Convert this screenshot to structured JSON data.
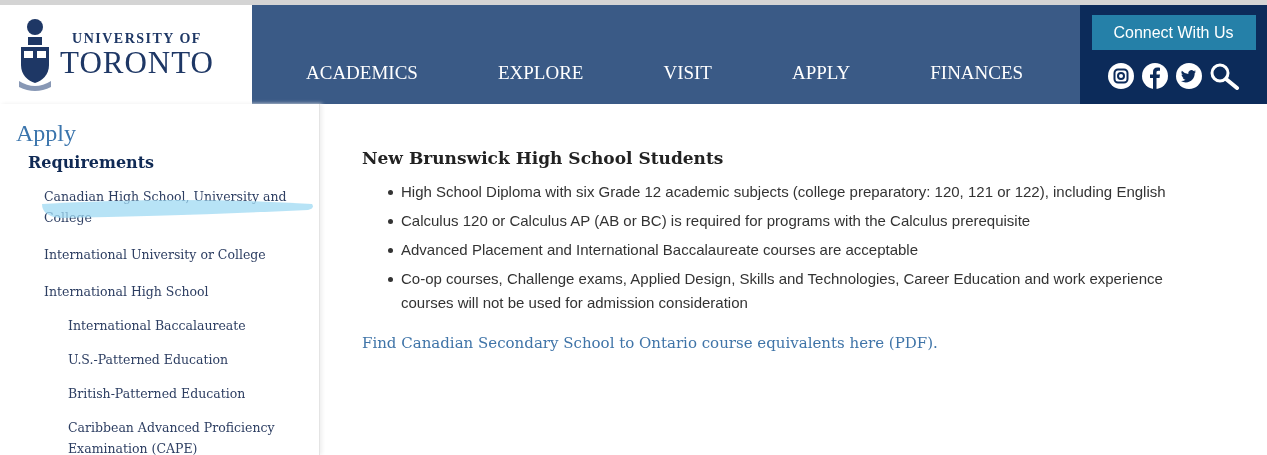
{
  "logo": {
    "line_1": "UNIVERSITY OF",
    "line_2": "TORONTO"
  },
  "nav": [
    {
      "label": "ACADEMICS"
    },
    {
      "label": "EXPLORE"
    },
    {
      "label": "VISIT"
    },
    {
      "label": "APPLY"
    },
    {
      "label": "FINANCES"
    }
  ],
  "connect_button": "Connect With Us",
  "sidebar": {
    "title": "Apply",
    "section": "Requirements",
    "items": [
      {
        "label": "Canadian High School, University and College",
        "highlighted": true
      },
      {
        "label": "International University or College",
        "highlighted": false
      },
      {
        "label": "International High School",
        "highlighted": false,
        "children": [
          {
            "label": "International Baccalaureate",
            "highlighted": false
          },
          {
            "label": "U.S.-Patterned Education",
            "highlighted": false
          },
          {
            "label": "British-Patterned Education",
            "highlighted": false
          },
          {
            "label": "Caribbean Advanced Proficiency Examination (CAPE)",
            "highlighted": false
          }
        ]
      }
    ]
  },
  "content": {
    "heading": "New Brunswick High School Students",
    "bullets": [
      "High School Diploma with six Grade 12 academic subjects (college preparatory: 120, 121 or 122), including English",
      "Calculus 120 or Calculus AP (AB or BC) is required for programs with the Calculus prerequisite",
      "Advanced Placement and International Baccalaureate courses are acceptable",
      "Co-op courses, Challenge exams, Applied Design, Skills and Technologies, Career Education and work experience courses will not be used for admission consideration"
    ],
    "link": "Find Canadian Secondary School to Ontario course equivalents here (PDF)."
  }
}
